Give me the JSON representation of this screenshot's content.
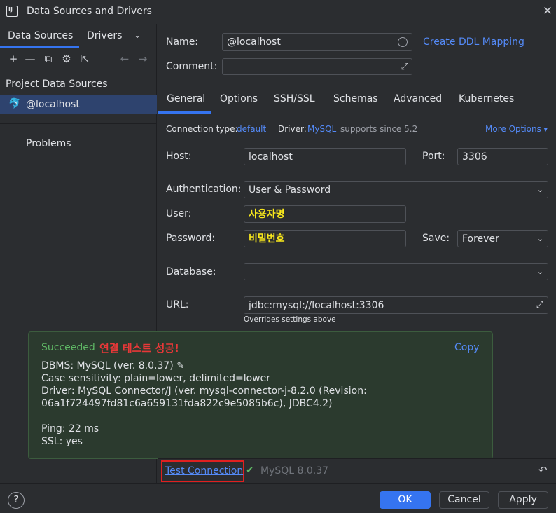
{
  "window": {
    "title": "Data Sources and Drivers",
    "logo": "IJ"
  },
  "left_panel": {
    "tabs": [
      "Data Sources",
      "Drivers"
    ],
    "toolbar_icons": [
      "add-icon",
      "remove-icon",
      "copy-icon",
      "settings-icon",
      "external-link-icon",
      "back-icon",
      "forward-icon"
    ],
    "section_title": "Project Data Sources",
    "items": [
      {
        "label": "@localhost",
        "icon": "mysql-icon"
      }
    ],
    "problems_label": "Problems"
  },
  "form": {
    "name_label": "Name:",
    "name_value": "@localhost",
    "ddl_link": "Create DDL Mapping",
    "comment_label": "Comment:",
    "comment_value": "",
    "tabs": [
      "General",
      "Options",
      "SSH/SSL",
      "Schemas",
      "Advanced",
      "Kubernetes"
    ],
    "active_tab": "General",
    "conn_type_label": "Connection type:",
    "conn_type_value": "default",
    "driver_label": "Driver:",
    "driver_value": "MySQL",
    "driver_note": "supports since 5.2",
    "more_options": "More Options",
    "host_label": "Host:",
    "host_value": "localhost",
    "port_label": "Port:",
    "port_value": "3306",
    "auth_label": "Authentication:",
    "auth_value": "User & Password",
    "user_label": "User:",
    "user_value": "사용자명",
    "password_label": "Password:",
    "password_value": "비밀번호",
    "save_label": "Save:",
    "save_value": "Forever",
    "database_label": "Database:",
    "database_value": "",
    "url_label": "URL:",
    "url_value": "jdbc:mysql://localhost:3306",
    "url_note": "Overrides settings above"
  },
  "popup": {
    "status": "Succeeded",
    "annotation": "연결 테스트 성공!",
    "copy": "Copy",
    "dbms": "DBMS: MySQL (ver. 8.0.37)",
    "case": "Case sensitivity: plain=lower, delimited=lower",
    "driver1": "Driver: MySQL Connector/J (ver. mysql-connector-j-8.2.0 (Revision:",
    "driver2": "06a1f724497fd81c6a659131fda822c9e5085b6c), JDBC4.2)",
    "ping": "Ping: 22 ms",
    "ssl": "SSL: yes"
  },
  "bottom": {
    "test_connection": "Test Connection",
    "mysql_version": "MySQL 8.0.37"
  },
  "footer": {
    "help": "?",
    "ok": "OK",
    "cancel": "Cancel",
    "apply": "Apply"
  },
  "colors": {
    "accent": "#3574f0",
    "link": "#548af7",
    "success": "#5fb865",
    "annotation_red": "#e83838",
    "highlight_yellow": "#f8e71c"
  }
}
